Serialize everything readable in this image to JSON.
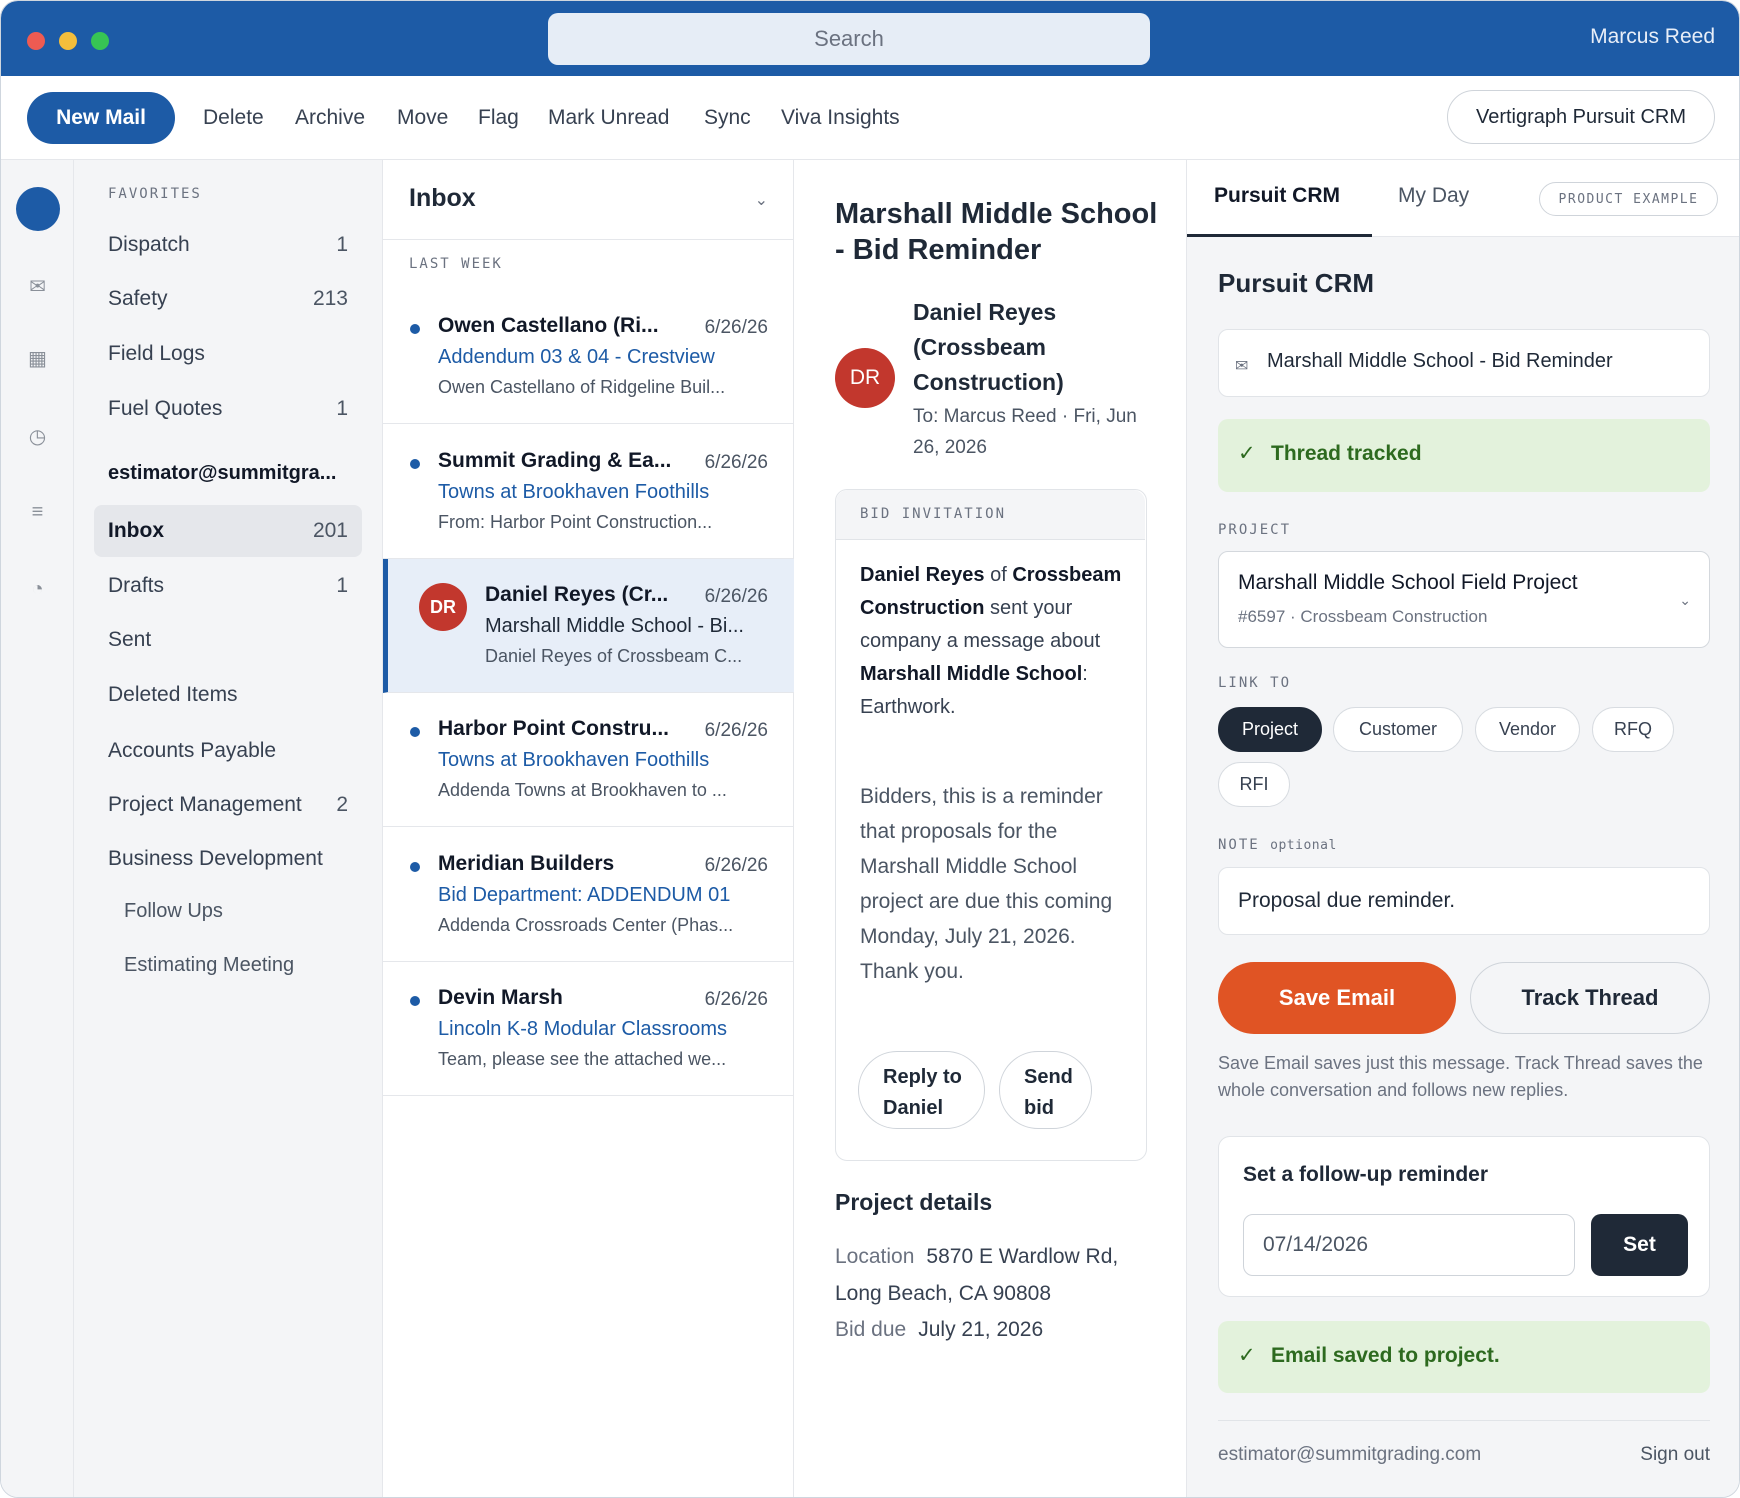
{
  "titlebar": {
    "search_placeholder": "Search",
    "user_name": "Marcus Reed"
  },
  "toolbar": {
    "new_mail": "New Mail",
    "items": [
      "Delete",
      "Archive",
      "Move",
      "Flag",
      "Mark Unread",
      "Sync",
      "Viva Insights"
    ],
    "crm_button": "Vertigraph Pursuit CRM"
  },
  "rail": {
    "icons": [
      "mail-icon",
      "calendar-icon",
      "clock-icon",
      "list-icon",
      "pie-chart-icon"
    ]
  },
  "folders": {
    "favorites_heading": "FAVORITES",
    "favorites": [
      {
        "name": "Dispatch",
        "count": "1"
      },
      {
        "name": "Safety",
        "count": "213"
      },
      {
        "name": "Field Logs",
        "count": ""
      },
      {
        "name": "Fuel Quotes",
        "count": "1"
      }
    ],
    "account": "estimator@summitgra...",
    "account_folders": [
      {
        "name": "Inbox",
        "count": "201"
      },
      {
        "name": "Drafts",
        "count": "1"
      },
      {
        "name": "Sent",
        "count": ""
      },
      {
        "name": "Deleted Items",
        "count": ""
      },
      {
        "name": "Accounts Payable",
        "count": ""
      },
      {
        "name": "Project Management",
        "count": "2"
      },
      {
        "name": "Business Development",
        "count": ""
      },
      {
        "name": "Follow Ups",
        "count": ""
      },
      {
        "name": "Estimating Meeting",
        "count": ""
      }
    ]
  },
  "message_list": {
    "title": "Inbox",
    "group_label": "LAST WEEK",
    "messages": [
      {
        "sender": "Owen Castellano (Ri...",
        "date": "6/26/26",
        "subject": "Addendum 03 & 04 - Crestview",
        "preview": "Owen Castellano of Ridgeline Buil..."
      },
      {
        "sender": "Summit Grading & Ea...",
        "date": "6/26/26",
        "subject": "Towns at Brookhaven Foothills",
        "preview": "From: Harbor Point Construction..."
      },
      {
        "sender": "Daniel Reyes (Cr...",
        "date": "6/26/26",
        "subject": "Marshall Middle School - Bi...",
        "preview": "Daniel Reyes of Crossbeam C...",
        "avatar": "DR"
      },
      {
        "sender": "Harbor Point Constru...",
        "date": "6/26/26",
        "subject": "Towns at Brookhaven Foothills",
        "preview": "Addenda Towns at Brookhaven to ..."
      },
      {
        "sender": "Meridian Builders",
        "date": "6/26/26",
        "subject": "Bid Department: ADDENDUM 01",
        "preview": "Addenda Crossroads Center (Phas..."
      },
      {
        "sender": "Devin Marsh",
        "date": "6/26/26",
        "subject": "Lincoln K-8 Modular Classrooms",
        "preview": "Team, please see the attached we..."
      }
    ]
  },
  "reading": {
    "subject": "Marshall Middle School - Bid Reminder",
    "avatar": "DR",
    "from": "Daniel Reyes (Crossbeam Construction)",
    "to_line": "To: Marcus Reed · Fri, Jun 26, 2026",
    "card_heading": "BID INVITATION",
    "summary": {
      "sender": "Daniel Reyes",
      "of": " of ",
      "company": "Crossbeam Construction",
      "mid": " sent your company a message about ",
      "project": "Marshall Middle School",
      "tail": ": Earthwork."
    },
    "body": "Bidders, this is a reminder that proposals for the Marshall Middle School project are due this coming Monday, July 21, 2026. Thank you.",
    "reply_button": "Reply to Daniel",
    "send_bid_button": "Send bid",
    "project_details_heading": "Project details",
    "location_label": "Location",
    "location_value": "5870 E Wardlow Rd, Long Beach, CA 90808",
    "bid_due_label": "Bid due",
    "bid_due_value": "July 21, 2026"
  },
  "crm": {
    "tabs": [
      "Pursuit CRM",
      "My Day"
    ],
    "badge": "PRODUCT EXAMPLE",
    "title": "Pursuit CRM",
    "email_subject": "Marshall Middle School - Bid Reminder",
    "tracked_text": "Thread tracked",
    "project_label": "PROJECT",
    "project_name": "Marshall Middle School Field Project",
    "project_meta": "#6597 · Crossbeam Construction",
    "link_to_label": "LINK TO",
    "link_options": [
      "Project",
      "Customer",
      "Vendor",
      "RFQ",
      "RFI"
    ],
    "link_selected": "Project",
    "note_label": "NOTE",
    "note_optional": "optional",
    "note_value": "Proposal due reminder.",
    "save_email": "Save Email",
    "track_thread": "Track Thread",
    "help_text": "Save Email saves just this message. Track Thread saves the whole conversation and follows new replies.",
    "followup_title": "Set a follow-up reminder",
    "followup_date": "07/14/2026",
    "set_button": "Set",
    "saved_text": "Email saved to project.",
    "footer_account": "estimator@summitgrading.com",
    "sign_out": "Sign out"
  },
  "colors": {
    "brand_blue": "#1d5ba6",
    "accent_orange": "#e05424",
    "success_green": "#2d6a1f",
    "avatar_red": "#c2372d"
  }
}
